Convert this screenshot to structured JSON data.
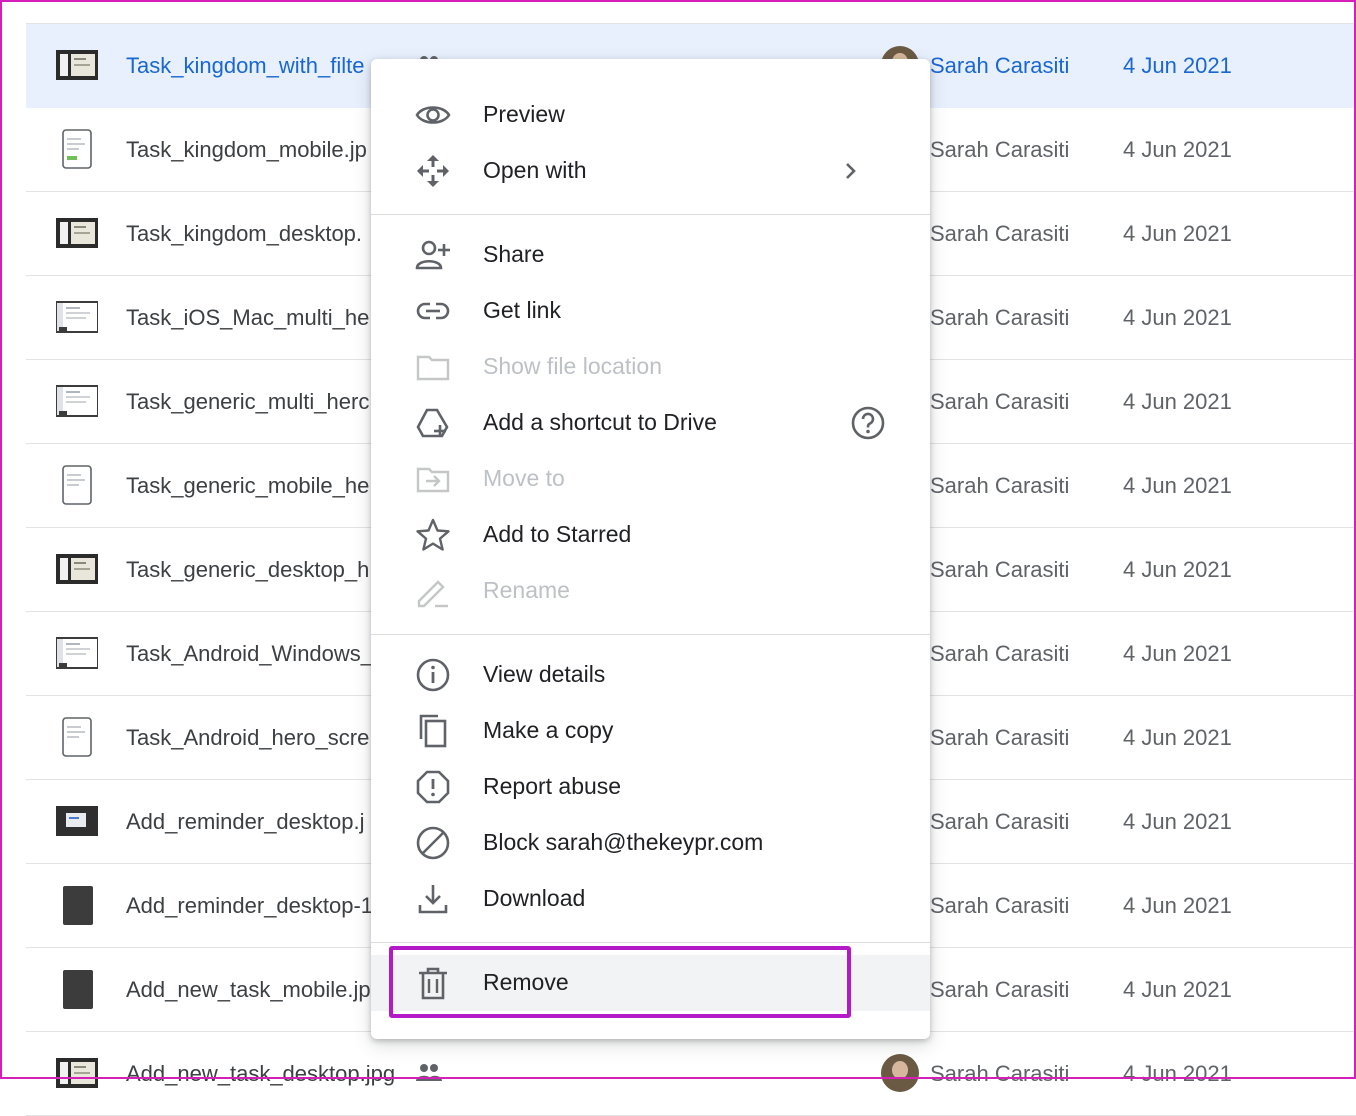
{
  "files": [
    {
      "name": "Task_kingdom_with_filte",
      "owner": "Sarah Carasiti",
      "date": "4 Jun 2021",
      "thumb": "dark",
      "shared": true,
      "selected": true
    },
    {
      "name": "Task_kingdom_mobile.jp",
      "owner": "Sarah Carasiti",
      "date": "4 Jun 2021",
      "thumb": "phone"
    },
    {
      "name": "Task_kingdom_desktop.",
      "owner": "Sarah Carasiti",
      "date": "4 Jun 2021",
      "thumb": "dark"
    },
    {
      "name": "Task_iOS_Mac_multi_he",
      "owner": "Sarah Carasiti",
      "date": "4 Jun 2021",
      "thumb": "light"
    },
    {
      "name": "Task_generic_multi_herc",
      "owner": "Sarah Carasiti",
      "date": "4 Jun 2021",
      "thumb": "light"
    },
    {
      "name": "Task_generic_mobile_he",
      "owner": "Sarah Carasiti",
      "date": "4 Jun 2021",
      "thumb": "phone-light"
    },
    {
      "name": "Task_generic_desktop_h",
      "owner": "Sarah Carasiti",
      "date": "4 Jun 2021",
      "thumb": "dark"
    },
    {
      "name": "Task_Android_Windows_",
      "owner": "Sarah Carasiti",
      "date": "4 Jun 2021",
      "thumb": "light"
    },
    {
      "name": "Task_Android_hero_scre",
      "owner": "Sarah Carasiti",
      "date": "4 Jun 2021",
      "thumb": "phone-light"
    },
    {
      "name": "Add_reminder_desktop.j",
      "owner": "Sarah Carasiti",
      "date": "4 Jun 2021",
      "thumb": "dark-box"
    },
    {
      "name": "Add_reminder_desktop-1",
      "owner": "Sarah Carasiti",
      "date": "4 Jun 2021",
      "thumb": "phone-dark"
    },
    {
      "name": "Add_new_task_mobile.jp",
      "owner": "Sarah Carasiti",
      "date": "4 Jun 2021",
      "thumb": "phone-dark"
    },
    {
      "name": "Add_new_task_desktop.jpg",
      "owner": "Sarah Carasiti",
      "date": "4 Jun 2021",
      "thumb": "dark",
      "shared": true
    }
  ],
  "menu": {
    "preview": "Preview",
    "open_with": "Open with",
    "share": "Share",
    "get_link": "Get link",
    "show_location": "Show file location",
    "add_shortcut": "Add a shortcut to Drive",
    "move_to": "Move to",
    "add_starred": "Add to Starred",
    "rename": "Rename",
    "view_details": "View details",
    "make_copy": "Make a copy",
    "report_abuse": "Report abuse",
    "block": "Block sarah@thekeypr.com",
    "download": "Download",
    "remove": "Remove"
  },
  "colors": {
    "accent": "#1967d2",
    "highlight_border": "#b51ac9",
    "selected_row": "#e8f0fe"
  }
}
